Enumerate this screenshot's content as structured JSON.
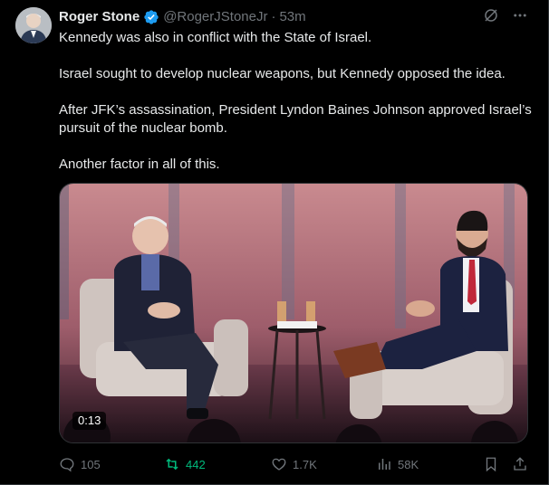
{
  "author": {
    "name": "Roger Stone",
    "handle": "@RogerJStoneJr",
    "time": "53m",
    "verified": true,
    "avatar_icon": "profile-photo"
  },
  "tweet": {
    "paragraphs": [
      "Kennedy was also in conflict with the State of Israel.",
      "Israel sought to develop nuclear weapons, but Kennedy opposed the idea.",
      "After JFK’s assassination, President Lyndon Baines Johnson approved Israel’s pursuit of the nuclear bomb.",
      "Another factor in all of this."
    ]
  },
  "media": {
    "type": "video",
    "duration": "0:13"
  },
  "actions": {
    "replies": "105",
    "reposts": "442",
    "likes": "1.7K",
    "views": "58K"
  },
  "colors": {
    "background": "#000000",
    "text": "#e7e9ea",
    "muted": "#71767b",
    "verified": "#1d9bf0",
    "repost_active": "#00ba7c"
  }
}
